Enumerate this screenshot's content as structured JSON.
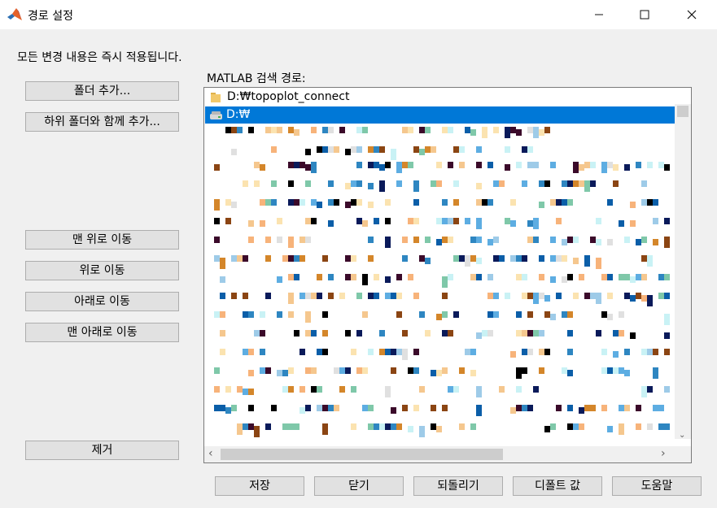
{
  "window": {
    "title": "경로 설정",
    "controls": {
      "minimize": "—",
      "maximize": "☐",
      "close": "✕"
    }
  },
  "notice": "모든 변경 내용은 즉시 적용됩니다.",
  "left_buttons": {
    "add_folder": "폴더 추가...",
    "add_with_subfolders": "하위 폴더와 함께 추가...",
    "move_to_top": "맨 위로 이동",
    "move_up": "위로 이동",
    "move_down": "아래로 이동",
    "move_to_bottom": "맨 아래로 이동",
    "remove": "제거"
  },
  "path_list": {
    "label": "MATLAB 검색 경로:",
    "items": [
      {
        "text": "D:₩topoplot_connect",
        "icon": "folder-icon"
      },
      {
        "text": "D:₩",
        "icon": "drive-icon",
        "selected": true
      }
    ]
  },
  "bottom_buttons": {
    "save": "저장",
    "close": "닫기",
    "revert": "되돌리기",
    "default": "디폴트 값",
    "help": "도움말"
  },
  "colors": {
    "selection": "#0078d7",
    "button_bg": "#e1e1e1",
    "dialog_bg": "#f0f0f0"
  }
}
